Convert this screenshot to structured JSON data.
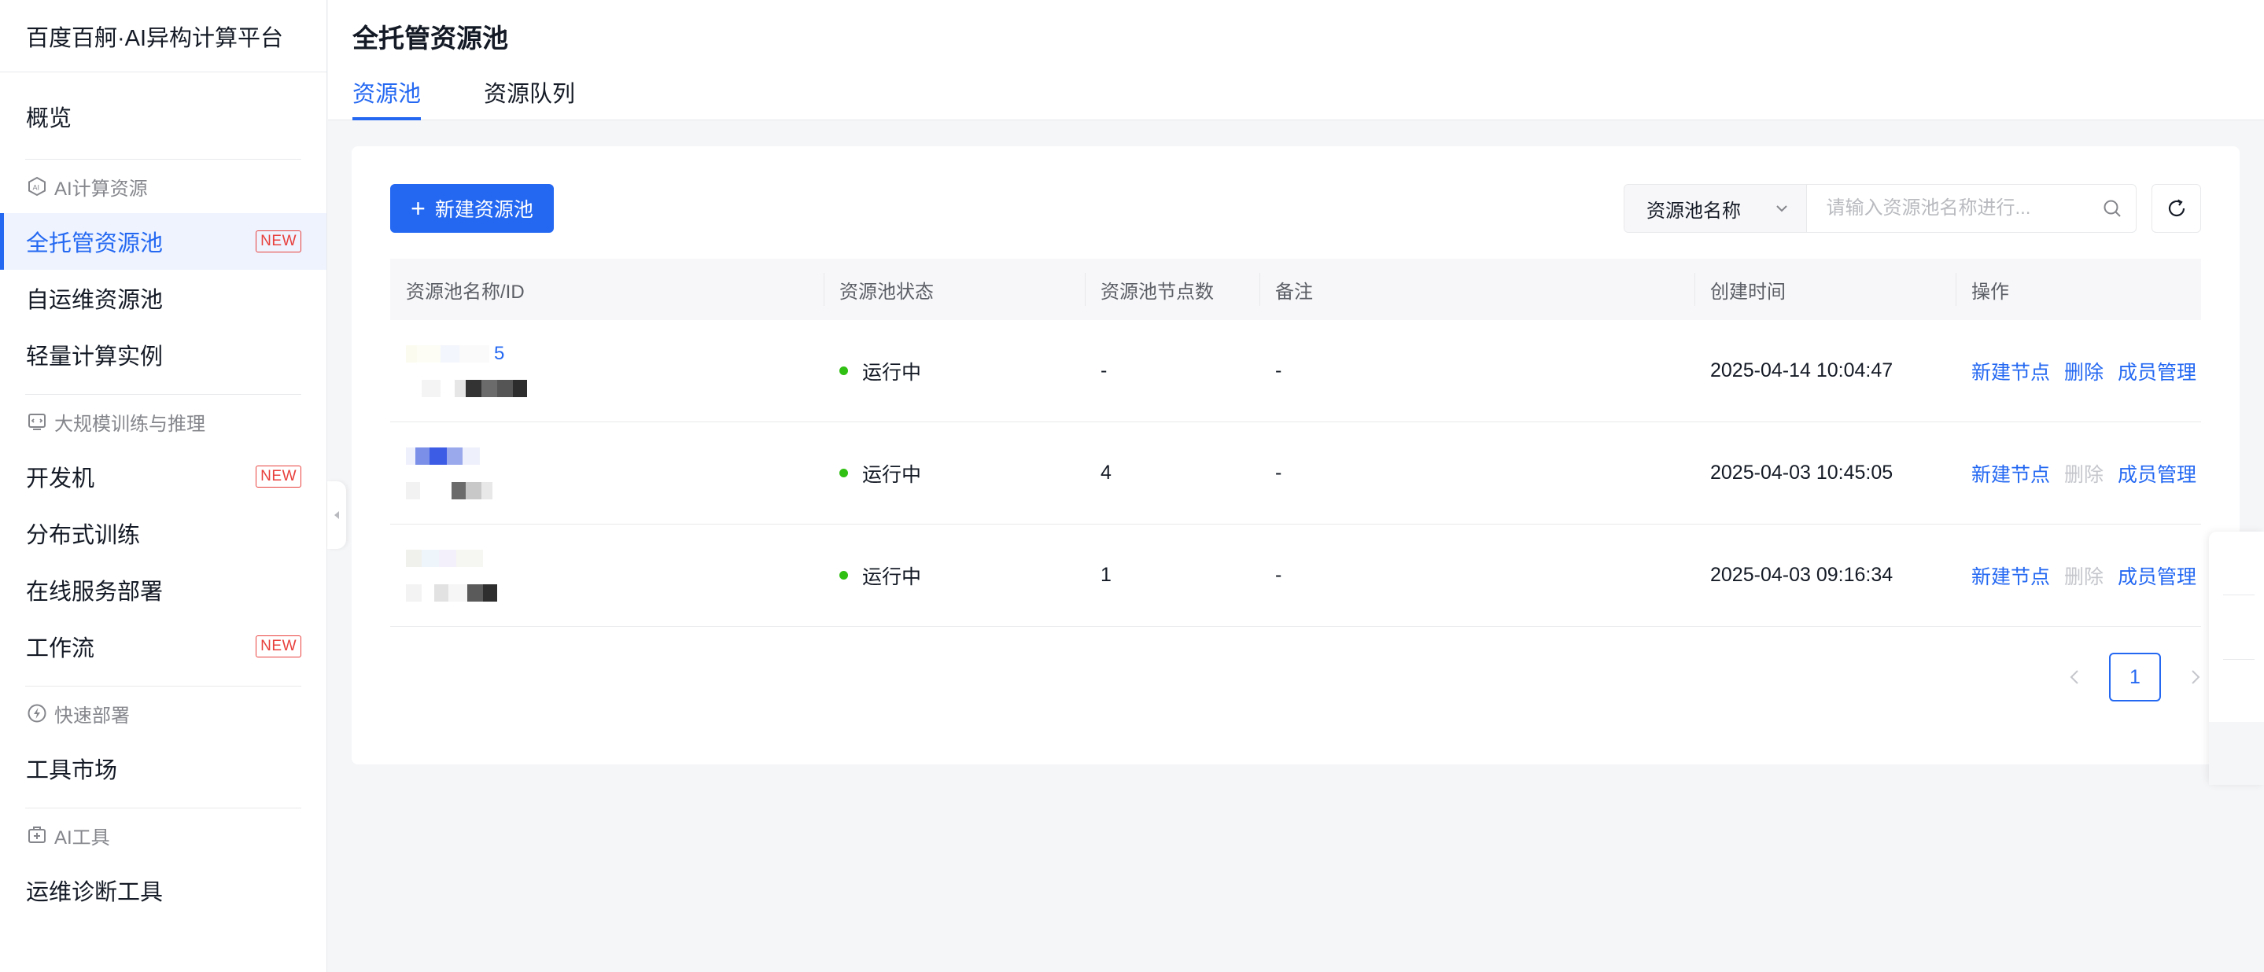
{
  "sidebar": {
    "brand": "百度百舸·AI异构计算平台",
    "overview": "概览",
    "groups": [
      {
        "title": "AI计算资源",
        "icon": "ai-chip-icon",
        "items": [
          {
            "label": "全托管资源池",
            "badge": "NEW",
            "active": true
          },
          {
            "label": "自运维资源池"
          },
          {
            "label": "轻量计算实例"
          }
        ]
      },
      {
        "title": "大规模训练与推理",
        "icon": "code-window-icon",
        "items": [
          {
            "label": "开发机",
            "badge": "NEW"
          },
          {
            "label": "分布式训练"
          },
          {
            "label": "在线服务部署"
          },
          {
            "label": "工作流",
            "badge": "NEW"
          }
        ]
      },
      {
        "title": "快速部署",
        "icon": "lightning-icon",
        "items": [
          {
            "label": "工具市场"
          }
        ]
      },
      {
        "title": "AI工具",
        "icon": "tool-box-icon",
        "items": [
          {
            "label": "运维诊断工具"
          }
        ]
      }
    ]
  },
  "header": {
    "title": "全托管资源池",
    "tabs": [
      {
        "label": "资源池",
        "active": true
      },
      {
        "label": "资源队列"
      }
    ]
  },
  "toolbar": {
    "create_label": "新建资源池",
    "search_field": "资源池名称",
    "search_placeholder": "请输入资源池名称进行..."
  },
  "table": {
    "columns": [
      "资源池名称/ID",
      "资源池状态",
      "资源池节点数",
      "备注",
      "创建时间",
      "操作"
    ],
    "rows": [
      {
        "name_suffix": "5",
        "status": "运行中",
        "nodes": "-",
        "remark": "-",
        "created": "2025-04-14 10:04:47",
        "actions": [
          "新建节点",
          "删除",
          "成员管理"
        ],
        "delete_disabled": false
      },
      {
        "name_suffix": "",
        "status": "运行中",
        "nodes": "4",
        "remark": "-",
        "created": "2025-04-03 10:45:05",
        "actions": [
          "新建节点",
          "删除",
          "成员管理"
        ],
        "delete_disabled": true
      },
      {
        "name_suffix": "",
        "status": "运行中",
        "nodes": "1",
        "remark": "-",
        "created": "2025-04-03 09:16:34",
        "actions": [
          "新建节点",
          "删除",
          "成员管理"
        ],
        "delete_disabled": true
      }
    ]
  },
  "pagination": {
    "current": "1"
  },
  "colors": {
    "primary": "#2468f2",
    "running": "#30bf13",
    "new_badge": "#e8413d"
  }
}
